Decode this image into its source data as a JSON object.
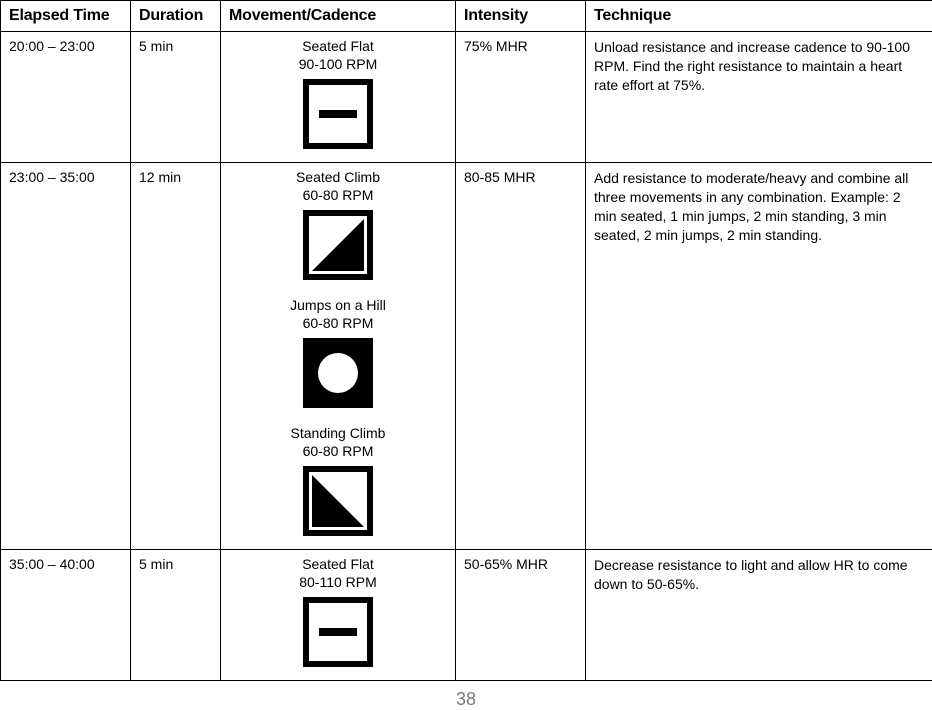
{
  "headers": {
    "elapsed": "Elapsed Time",
    "duration": "Duration",
    "movement": "Movement/Cadence",
    "intensity": "Intensity",
    "technique": "Technique"
  },
  "rows": [
    {
      "elapsed": "20:00 – 23:00",
      "duration": "5 min",
      "intensity": "75% MHR",
      "technique": "Unload resistance and increase cadence to 90-100 RPM. Find the right resistance to maintain a heart rate effort at 75%.",
      "movements": [
        {
          "name": "Seated Flat",
          "rpm": "90-100 RPM",
          "icon": "flat"
        }
      ]
    },
    {
      "elapsed": "23:00 – 35:00",
      "duration": "12 min",
      "intensity": "80-85 MHR",
      "technique": "Add resistance to moderate/heavy and combine all three movements in any combination. Example: 2 min seated, 1 min jumps, 2 min standing, 3 min seated, 2 min jumps, 2 min standing.",
      "movements": [
        {
          "name": "Seated Climb",
          "rpm": "60-80 RPM",
          "icon": "climb-seated"
        },
        {
          "name": "Jumps on a Hill",
          "rpm": "60-80 RPM",
          "icon": "jumps"
        },
        {
          "name": "Standing Climb",
          "rpm": "60-80 RPM",
          "icon": "climb-standing"
        }
      ]
    },
    {
      "elapsed": "35:00 – 40:00",
      "duration": "5 min",
      "intensity": "50-65% MHR",
      "technique": "Decrease resistance to light and allow HR to come down to 50-65%.",
      "movements": [
        {
          "name": "Seated Flat",
          "rpm": "80-110 RPM",
          "icon": "flat"
        }
      ]
    }
  ],
  "page_number": "38"
}
